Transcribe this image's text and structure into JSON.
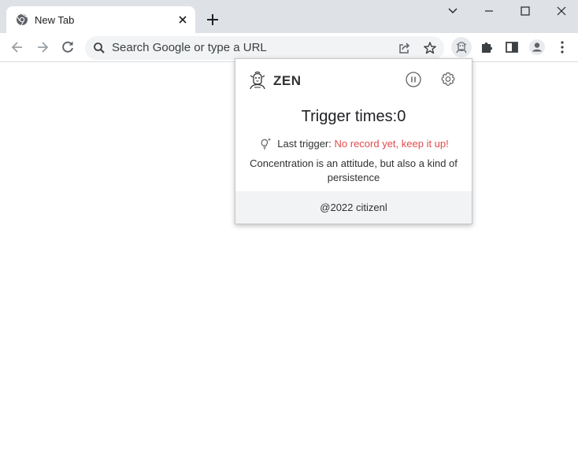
{
  "browser": {
    "tab": {
      "title": "New Tab",
      "icon": "chrome-icon"
    },
    "new_tab_icon": "plus-icon",
    "window_controls": [
      "chevron-down-icon",
      "minimize-icon",
      "maximize-icon",
      "close-icon"
    ],
    "omnibox": {
      "placeholder": "Search Google or type a URL"
    },
    "toolbar_icons": [
      "share-icon",
      "star-icon",
      "zen-extension-icon",
      "puzzle-icon",
      "side-panel-icon",
      "profile-icon",
      "kebab-menu-icon"
    ]
  },
  "popup": {
    "title": "ZEN",
    "trigger_label": "Trigger times:",
    "trigger_count": "0",
    "last_trigger_label": "Last trigger:",
    "last_trigger_value": "No record yet, keep it up!",
    "quote": "Concentration is an attitude, but also a kind of persistence",
    "footer": "@2022 citizenl",
    "accent_color": "#e04b4b"
  }
}
